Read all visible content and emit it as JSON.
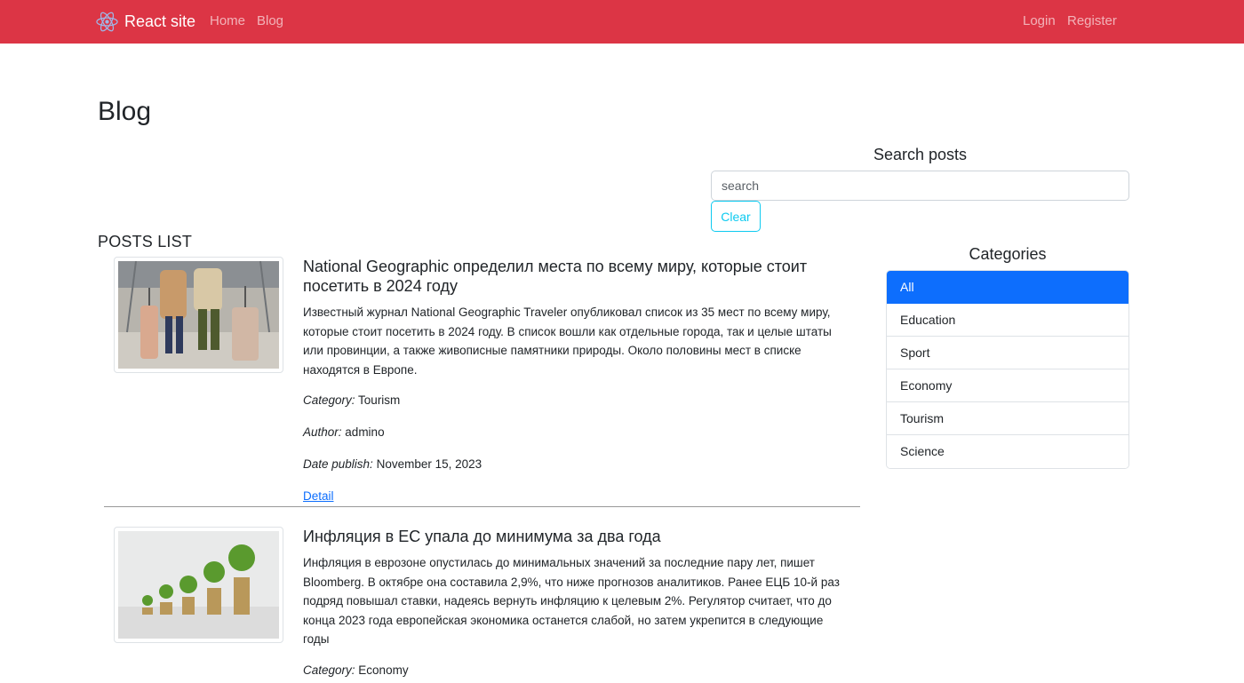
{
  "navbar": {
    "brand": "React site",
    "links": [
      "Home",
      "Blog"
    ],
    "auth": [
      "Login",
      "Register"
    ]
  },
  "page": {
    "title": "Blog"
  },
  "search": {
    "title": "Search posts",
    "placeholder": "search",
    "clear_label": "Clear"
  },
  "posts_heading": "POSTS LIST",
  "posts": [
    {
      "title": "National Geographic определил места по всему миру, которые стоит посетить в 2024 году",
      "text": "Известный журнал National Geographic Traveler опубликовал список из 35 мест по всему миру, которые стоит посетить в 2024 году. В список вошли как отдельные города, так и целые штаты или провинции, а также живописные памятники природы. Около половины мест в списке находятся в Европе.",
      "category_label": "Category:",
      "category": "Tourism",
      "author_label": "Author:",
      "author": "admino",
      "date_label": "Date publish:",
      "date": "November 15, 2023",
      "detail": "Detail"
    },
    {
      "title": "Инфляция в ЕС упала до минимума за два года",
      "text": "Инфляция в еврозоне опустилась до минимальных значений за последние пару лет, пишет Bloomberg. В октябре она составила 2,9%, что ниже прогнозов аналитиков. Ранее ЕЦБ 10-й раз подряд повышал ставки, надеясь вернуть инфляцию к целевым 2%. Регулятор считает, что до конца 2023 года европейская экономика останется слабой, но затем укрепится в следующие годы",
      "category_label": "Category:",
      "category": "Economy"
    }
  ],
  "categories": {
    "title": "Categories",
    "items": [
      "All",
      "Education",
      "Sport",
      "Economy",
      "Tourism",
      "Science"
    ],
    "active": "All"
  },
  "colors": {
    "navbar": "#dc3545",
    "active": "#0d6efd",
    "info": "#0dcaf0"
  }
}
